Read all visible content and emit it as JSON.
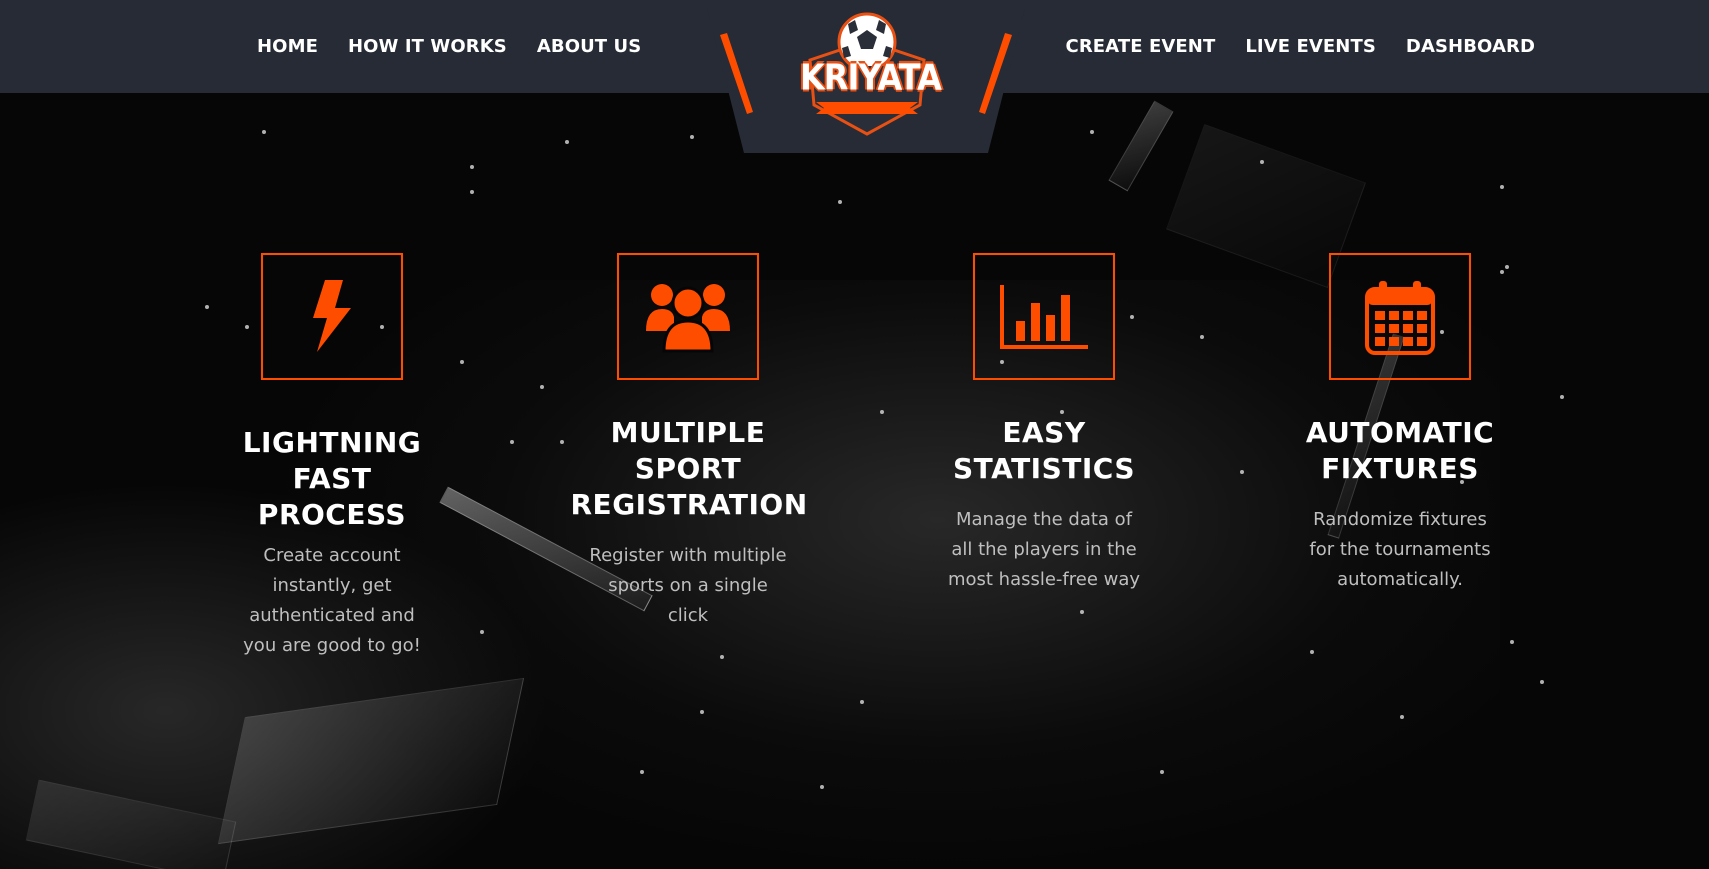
{
  "nav": {
    "left": [
      {
        "label": "HOME"
      },
      {
        "label": "HOW IT WORKS"
      },
      {
        "label": "ABOUT US"
      }
    ],
    "right": [
      {
        "label": "CREATE EVENT"
      },
      {
        "label": "LIVE EVENTS"
      },
      {
        "label": "DASHBOARD"
      }
    ]
  },
  "logo": {
    "text": "KRIYATA",
    "icon": "soccer-ball-icon"
  },
  "colors": {
    "accent": "#ff4d00",
    "header_bg": "#272b35",
    "page_bg": "#060606",
    "body_text": "#bfbfbf"
  },
  "features": [
    {
      "icon": "lightning-icon",
      "title": "LIGHTNING FAST PROCESS",
      "description": "Create account instantly, get authenticated and you are good to go!"
    },
    {
      "icon": "users-group-icon",
      "title": "MULTIPLE SPORT REGISTRATION",
      "description": "Register with multiple sports on a single click"
    },
    {
      "icon": "bar-chart-icon",
      "title": "EASY STATISTICS",
      "description": "Manage the data of all the players in the most hassle-free way"
    },
    {
      "icon": "calendar-icon",
      "title": "AUTOMATIC FIXTURES",
      "description": "Randomize fixtures for the tournaments automatically."
    }
  ]
}
